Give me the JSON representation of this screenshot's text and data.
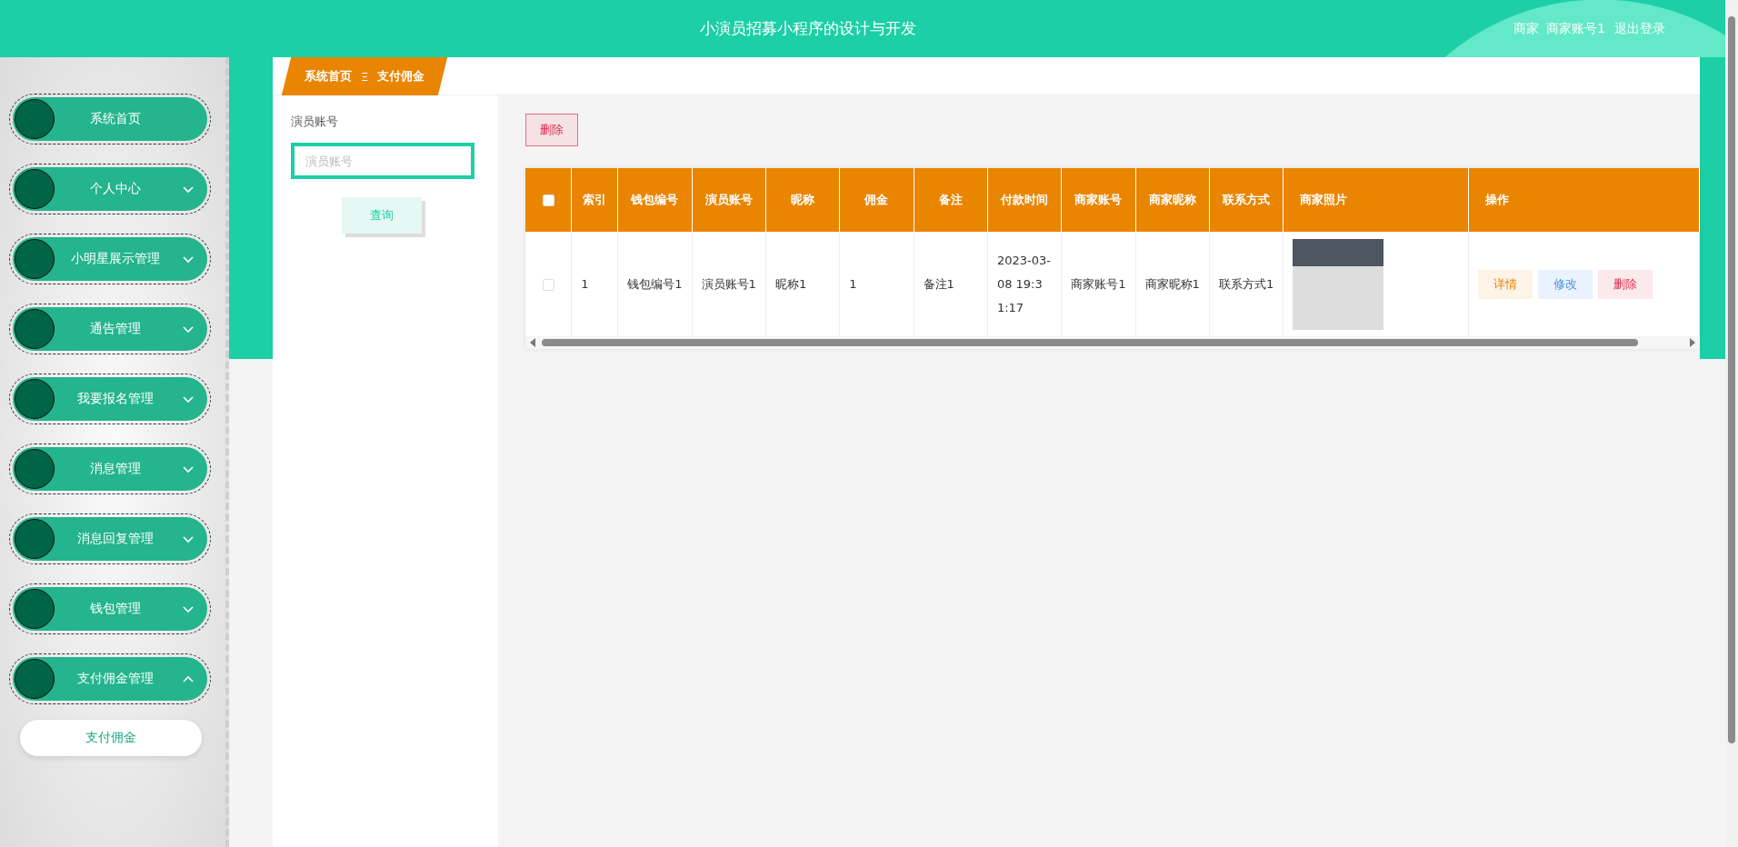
{
  "header": {
    "title": "小演员招募小程序的设计与开发",
    "role": "商家",
    "account": "商家账号1",
    "logout": "退出登录"
  },
  "sidebar": {
    "items": [
      {
        "kind": "link",
        "label": "系统首页"
      },
      {
        "kind": "group",
        "label": "个人中心",
        "expanded": false
      },
      {
        "kind": "group",
        "label": "小明星展示管理",
        "expanded": false
      },
      {
        "kind": "group",
        "label": "通告管理",
        "expanded": false
      },
      {
        "kind": "group",
        "label": "我要报名管理",
        "expanded": false
      },
      {
        "kind": "group",
        "label": "消息管理",
        "expanded": false
      },
      {
        "kind": "group",
        "label": "消息回复管理",
        "expanded": false
      },
      {
        "kind": "group",
        "label": "钱包管理",
        "expanded": false
      },
      {
        "kind": "group",
        "label": "支付佣金管理",
        "expanded": true,
        "children": [
          {
            "label": "支付佣金",
            "selected": true
          }
        ]
      }
    ]
  },
  "breadcrumb": {
    "items": [
      "系统首页",
      "支付佣金"
    ],
    "separator": "Ξ"
  },
  "search": {
    "label": "演员账号",
    "placeholder": "演员账号",
    "button": "查询"
  },
  "toolbar": {
    "delete": "删除"
  },
  "table": {
    "select_all": false,
    "columns": [
      {
        "kind": "check"
      },
      {
        "kind": "text",
        "label": "索引"
      },
      {
        "kind": "text",
        "label": "钱包编号"
      },
      {
        "kind": "text",
        "label": "演员账号"
      },
      {
        "kind": "text",
        "label": "昵称"
      },
      {
        "kind": "text",
        "label": "佣金"
      },
      {
        "kind": "text",
        "label": "备注"
      },
      {
        "kind": "text",
        "label": "付款时间"
      },
      {
        "kind": "text",
        "label": "商家账号"
      },
      {
        "kind": "text",
        "label": "商家昵称"
      },
      {
        "kind": "text",
        "label": "联系方式"
      },
      {
        "kind": "photo",
        "label": "商家照片"
      },
      {
        "kind": "actions",
        "label": "操作"
      }
    ],
    "rows": [
      {
        "checked": false,
        "cells": [
          "",
          "1",
          "钱包编号1",
          "演员账号1",
          "昵称1",
          "1",
          "备注1",
          "2023-03-08 19:31:17",
          "商家账号1",
          "商家昵称1",
          "联系方式1"
        ],
        "actions": [
          {
            "kind": "detail",
            "label": "详情"
          },
          {
            "kind": "edit",
            "label": "修改"
          },
          {
            "kind": "delete",
            "label": "删除"
          }
        ]
      }
    ]
  }
}
